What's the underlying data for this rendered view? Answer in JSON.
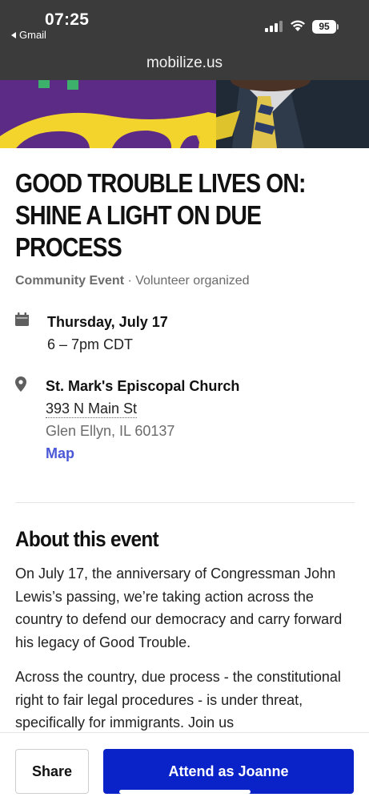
{
  "status_bar": {
    "time": "07:25",
    "back_app": "Gmail",
    "battery": "95"
  },
  "browser": {
    "url": "mobilize.us"
  },
  "hero": {
    "colors": {
      "purple": "#5b2b86",
      "yellow": "#f3d42c",
      "green": "#3db16b"
    }
  },
  "event": {
    "title": "GOOD TROUBLE LIVES ON: SHINE A LIGHT ON DUE PROCESS",
    "type": "Community Event",
    "separator": " · ",
    "organizer": "Volunteer organized",
    "date": "Thursday, July 17",
    "time_range": "6 – 7pm CDT",
    "venue": "St. Mark's Episcopal Church",
    "street": "393 N Main St",
    "city_line": "Glen Ellyn, IL 60137",
    "map_label": "Map"
  },
  "about": {
    "heading": "About this event",
    "paragraph1": "On July 17, the anniversary of Congressman John Lewis’s passing, we’re taking action across the country to defend our democracy and carry forward his legacy of Good Trouble.",
    "paragraph2": "Across the country, due process - the constitutional right to fair legal procedures - is under threat, specifically for immigrants. Join us"
  },
  "actions": {
    "share_label": "Share",
    "attend_label": "Attend as Joanne",
    "attend_color": "#0a23c8",
    "link_color": "#4a58d8"
  }
}
